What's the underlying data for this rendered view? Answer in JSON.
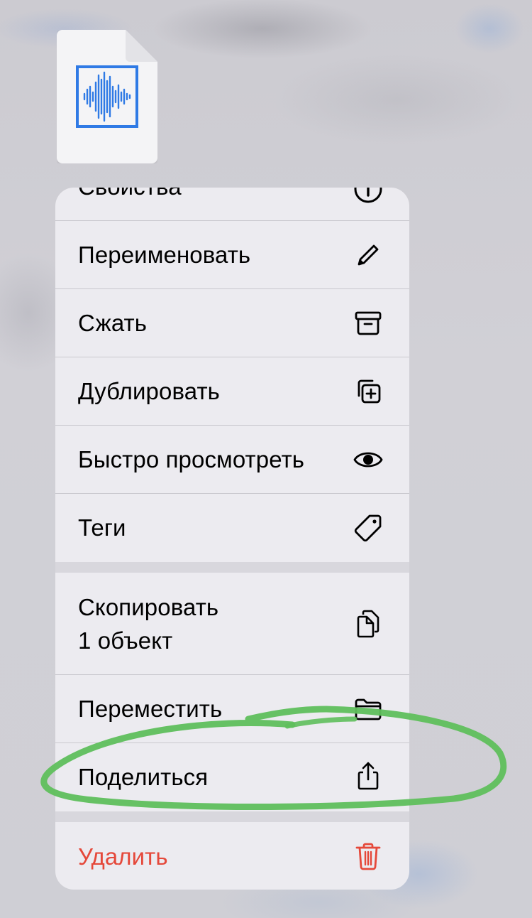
{
  "file": {
    "icon": "audio-waveform-icon",
    "accent_color": "#2f7ae5"
  },
  "menu": {
    "items": [
      {
        "label": "Свойства",
        "icon": "info-icon"
      },
      {
        "label": "Переименовать",
        "icon": "pencil-icon"
      },
      {
        "label": "Сжать",
        "icon": "archive-box-icon"
      },
      {
        "label": "Дублировать",
        "icon": "duplicate-icon"
      },
      {
        "label": "Быстро просмотреть",
        "icon": "eye-icon"
      },
      {
        "label": "Теги",
        "icon": "tag-icon"
      },
      {
        "label": "Скопировать",
        "label2": "1 объект",
        "icon": "copy-doc-icon"
      },
      {
        "label": "Переместить",
        "icon": "folder-icon"
      },
      {
        "label": "Поделиться",
        "icon": "share-icon"
      },
      {
        "label": "Удалить",
        "icon": "trash-icon",
        "color": "#e5483a"
      }
    ]
  },
  "annotation": {
    "color": "#5fbf5c",
    "target": "Поделиться"
  }
}
